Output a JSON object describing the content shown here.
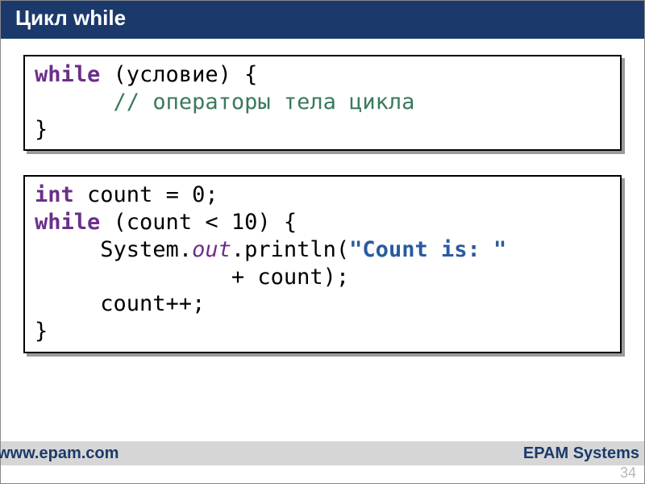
{
  "title": "Цикл while",
  "code1": {
    "line1_kw": "while",
    "line1_rest": " (условие) {",
    "line2_indent": "      ",
    "line2_comment": "// операторы тела цикла",
    "line3": "}"
  },
  "code2": {
    "l1_kw": "int",
    "l1_rest": " count = 0;",
    "l2_kw": "while",
    "l2_rest": " (count < 10) {",
    "l3_indent": "     ",
    "l3_a": "System.",
    "l3_out": "out",
    "l3_b": ".println(",
    "l3_str": "\"Count is: \"",
    "l4": "               + count);",
    "l5": "     count++;",
    "l6": "}"
  },
  "footer": {
    "left": "www.epam.com",
    "right": "EPAM Systems"
  },
  "page_number": "34"
}
